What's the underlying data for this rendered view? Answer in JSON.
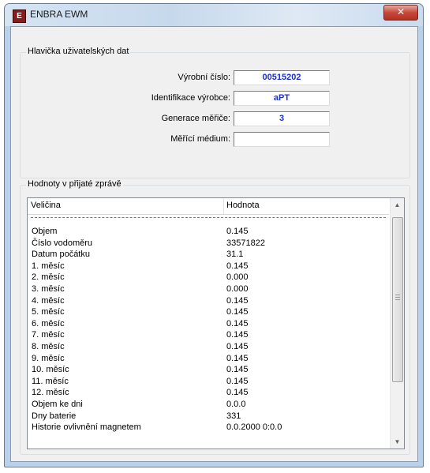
{
  "window": {
    "title": "ENBRA EWM",
    "close_glyph": "✕"
  },
  "header_group": {
    "legend": "Hlavička uživatelských dat",
    "fields": [
      {
        "label": "Výrobní číslo:",
        "value": "00515202"
      },
      {
        "label": "Identifikace výrobce:",
        "value": "aPT"
      },
      {
        "label": "Generace měřiče:",
        "value": "3"
      },
      {
        "label": "Měřící médium:",
        "value": ""
      }
    ]
  },
  "values_group": {
    "legend": "Hodnoty v přijaté zprávě",
    "columns": [
      "Veličina",
      "Hodnota"
    ],
    "rows": [
      {
        "name": "Objem",
        "value": "0.145"
      },
      {
        "name": "Číslo vodoměru",
        "value": "33571822"
      },
      {
        "name": "Datum počátku",
        "value": "31.1"
      },
      {
        "name": "1. měsíc",
        "value": "0.145"
      },
      {
        "name": "2. měsíc",
        "value": "0.000"
      },
      {
        "name": "3. měsíc",
        "value": "0.000"
      },
      {
        "name": "4. měsíc",
        "value": "0.145"
      },
      {
        "name": "5. měsíc",
        "value": "0.145"
      },
      {
        "name": "6. měsíc",
        "value": "0.145"
      },
      {
        "name": "7. měsíc",
        "value": "0.145"
      },
      {
        "name": "8. měsíc",
        "value": "0.145"
      },
      {
        "name": "9. měsíc",
        "value": "0.145"
      },
      {
        "name": "10. měsíc",
        "value": "0.145"
      },
      {
        "name": "11. měsíc",
        "value": "0.145"
      },
      {
        "name": "12. měsíc",
        "value": "0.145"
      },
      {
        "name": "Objem ke dni",
        "value": "0.0.0"
      },
      {
        "name": "Dny baterie",
        "value": "331"
      },
      {
        "name": "Historie ovlivnění magnetem",
        "value": "0.0.2000 0:0.0"
      }
    ],
    "scroll_up_glyph": "▲",
    "scroll_down_glyph": "▼"
  },
  "colors": {
    "field_value": "#1b2fcf",
    "close_button": "#c7483a"
  }
}
